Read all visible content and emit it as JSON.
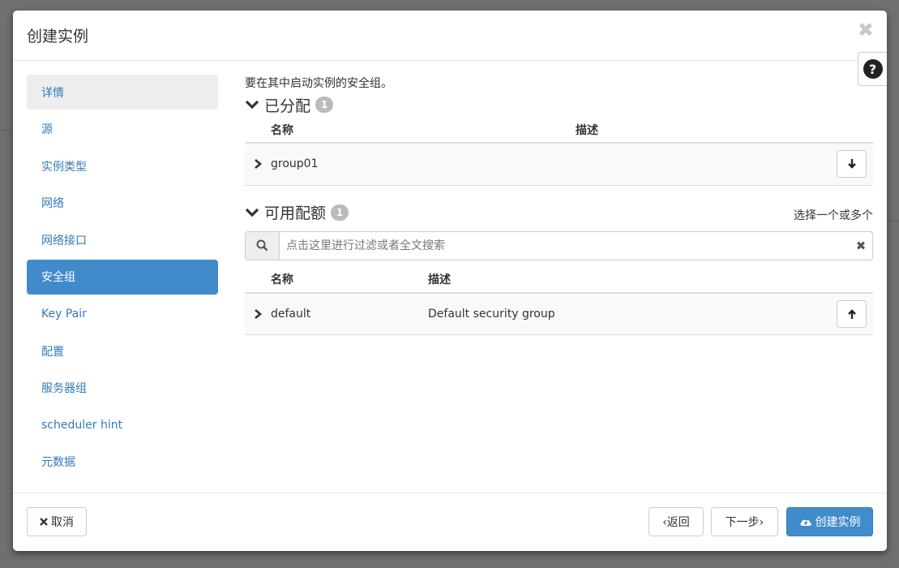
{
  "modal": {
    "title": "创建实例",
    "close_label": "✖",
    "help_label": "?"
  },
  "sidebar": {
    "items": [
      {
        "label": "详情"
      },
      {
        "label": "源"
      },
      {
        "label": "实例类型"
      },
      {
        "label": "网络"
      },
      {
        "label": "网络接口"
      },
      {
        "label": "安全组"
      },
      {
        "label": "Key Pair"
      },
      {
        "label": "配置"
      },
      {
        "label": "服务器组"
      },
      {
        "label": "scheduler hint"
      },
      {
        "label": "元数据"
      }
    ]
  },
  "content": {
    "intro": "要在其中启动实例的安全组。",
    "allocated": {
      "title": "已分配",
      "count": "1",
      "columns": [
        "名称",
        "描述"
      ],
      "rows": [
        {
          "name": "group01",
          "description": ""
        }
      ]
    },
    "available": {
      "title": "可用配额",
      "count": "1",
      "hint": "选择一个或多个",
      "search_placeholder": "点击这里进行过滤或者全文搜索",
      "columns": [
        "名称",
        "描述"
      ],
      "rows": [
        {
          "name": "default",
          "description": "Default security group"
        }
      ]
    }
  },
  "footer": {
    "cancel": "取消",
    "back": "‹返回",
    "next": "下一步›",
    "create": "创建实例"
  },
  "icons": {
    "accent": "#428bca"
  }
}
